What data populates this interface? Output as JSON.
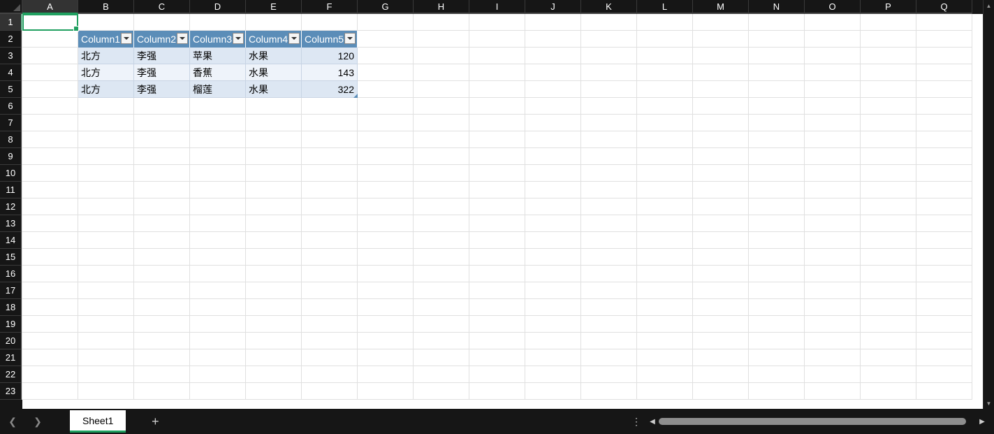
{
  "columns": [
    "A",
    "B",
    "C",
    "D",
    "E",
    "F",
    "G",
    "H",
    "I",
    "J",
    "K",
    "L",
    "M",
    "N",
    "O",
    "P",
    "Q"
  ],
  "row_count": 23,
  "active": {
    "col": "A",
    "row": 1
  },
  "table": {
    "start_col": 1,
    "start_row": 1,
    "headers": [
      "Column1",
      "Column2",
      "Column3",
      "Column4",
      "Column5"
    ],
    "rows": [
      [
        "北方",
        "李强",
        "苹果",
        "水果",
        "120"
      ],
      [
        "北方",
        "李强",
        "香蕉",
        "水果",
        "143"
      ],
      [
        "北方",
        "李强",
        "榴莲",
        "水果",
        "322"
      ]
    ],
    "numeric_cols": [
      4
    ]
  },
  "sheet": {
    "active": "Sheet1"
  },
  "vscroll": {
    "up": "▲",
    "down": "▼"
  },
  "hscroll": {
    "left": "◀",
    "right": "▶"
  },
  "more": "⋮",
  "add": "+"
}
